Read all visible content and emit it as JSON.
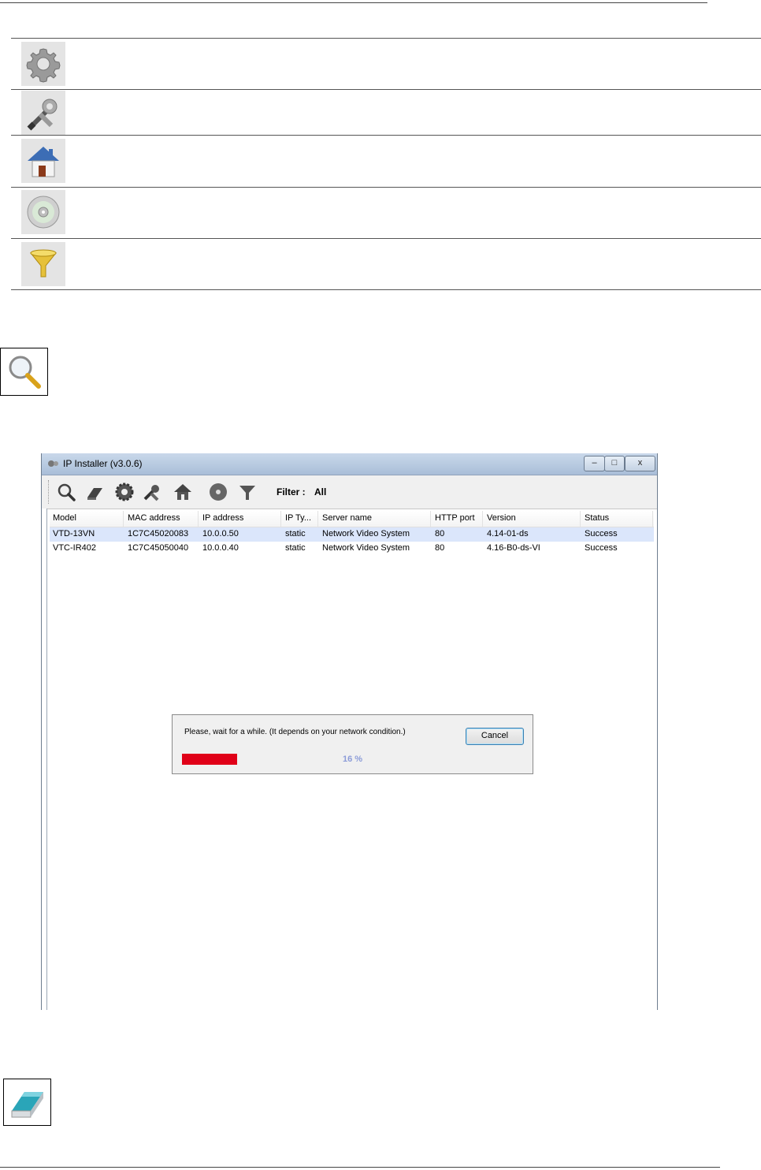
{
  "doc_icons": [
    {
      "name": "gear-icon"
    },
    {
      "name": "tools-icon"
    },
    {
      "name": "home-icon"
    },
    {
      "name": "disc-icon"
    },
    {
      "name": "funnel-icon"
    }
  ],
  "search_icon": "search-icon",
  "eraser_icon": "eraser-icon",
  "window": {
    "title": "IP Installer (v3.0.6)",
    "minimize": "‒",
    "maximize": "□",
    "close": "x"
  },
  "toolbar": {
    "buttons": [
      "search-icon",
      "eraser-icon",
      "gear-icon",
      "tools-icon",
      "home-icon",
      "disc-icon",
      "funnel-icon"
    ],
    "filter_label": "Filter :",
    "filter_value": "All"
  },
  "grid": {
    "columns": [
      "Model",
      "MAC address",
      "IP address",
      "IP Ty...",
      "Server name",
      "HTTP port",
      "Version",
      "Status"
    ],
    "rows": [
      [
        "VTD-13VN",
        "1C7C45020083",
        "10.0.0.50",
        "static",
        "Network Video System",
        "80",
        "4.14-01-ds",
        "Success"
      ],
      [
        "VTC-IR402",
        "1C7C45050040",
        "10.0.0.40",
        "static",
        "Network Video System",
        "80",
        "4.16-B0-ds-VI",
        "Success"
      ]
    ]
  },
  "dialog": {
    "message": "Please, wait for a while. (It depends on your network condition.)",
    "cancel_label": "Cancel",
    "progress_percent": 16,
    "progress_text": "16 %",
    "progress_color": "#e00018"
  }
}
